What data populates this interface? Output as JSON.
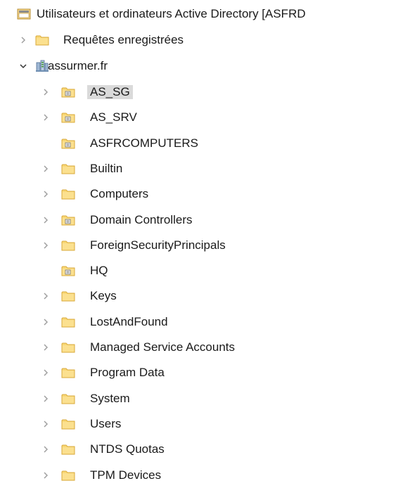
{
  "root": {
    "title": "Utilisateurs et ordinateurs Active Directory [ASFRD",
    "icon": "aduc-console-icon"
  },
  "saved_queries": {
    "label": "Requêtes enregistrées",
    "icon": "folder-icon",
    "expander": "collapsed"
  },
  "domain": {
    "label": "assurmer.fr",
    "icon": "domain-icon",
    "expander": "expanded"
  },
  "children": [
    {
      "label": "AS_SG",
      "type": "ou",
      "expander": "collapsed",
      "selected": true
    },
    {
      "label": "AS_SRV",
      "type": "ou",
      "expander": "collapsed"
    },
    {
      "label": "ASFRCOMPUTERS",
      "type": "ou",
      "expander": "none"
    },
    {
      "label": "Builtin",
      "type": "folder",
      "expander": "collapsed"
    },
    {
      "label": "Computers",
      "type": "folder",
      "expander": "collapsed"
    },
    {
      "label": "Domain Controllers",
      "type": "ou",
      "expander": "collapsed"
    },
    {
      "label": "ForeignSecurityPrincipals",
      "type": "folder",
      "expander": "collapsed"
    },
    {
      "label": "HQ",
      "type": "ou",
      "expander": "none"
    },
    {
      "label": "Keys",
      "type": "folder",
      "expander": "collapsed"
    },
    {
      "label": "LostAndFound",
      "type": "folder",
      "expander": "collapsed"
    },
    {
      "label": "Managed Service Accounts",
      "type": "folder",
      "expander": "collapsed"
    },
    {
      "label": "Program Data",
      "type": "folder",
      "expander": "collapsed"
    },
    {
      "label": "System",
      "type": "folder",
      "expander": "collapsed"
    },
    {
      "label": "Users",
      "type": "folder",
      "expander": "collapsed"
    },
    {
      "label": "NTDS Quotas",
      "type": "folder",
      "expander": "collapsed"
    },
    {
      "label": "TPM Devices",
      "type": "folder",
      "expander": "collapsed"
    }
  ],
  "colors": {
    "folder_fill": "#f8d775",
    "folder_edge": "#d9a93a",
    "selection": "#dadada",
    "expander": "#a0a0a0"
  }
}
